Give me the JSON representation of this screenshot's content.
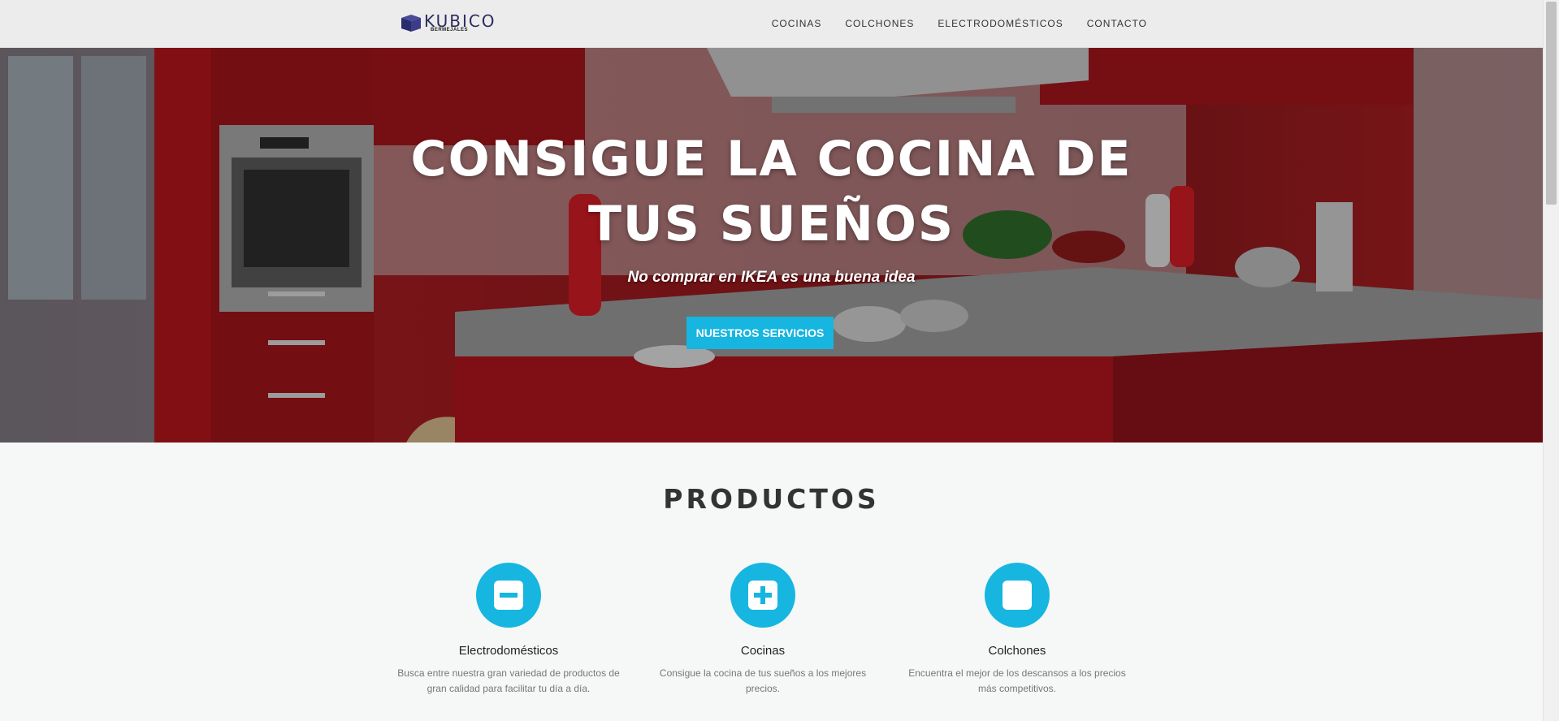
{
  "navbar": {
    "logo_text": "KUBICO",
    "logo_sub": "BERMEJALES",
    "links": [
      {
        "label": "COCINAS"
      },
      {
        "label": "COLCHONES"
      },
      {
        "label": "ELECTRODOMÉSTICOS"
      },
      {
        "label": "CONTACTO"
      }
    ]
  },
  "hero": {
    "title_line1": "CONSIGUE LA COCINA DE",
    "title_line2": "TUS SUEÑOS",
    "subtitle": "No comprar en IKEA es una buena idea",
    "button_label": "NUESTROS SERVICIOS"
  },
  "products": {
    "title": "PRODUCTOS",
    "items": [
      {
        "icon": "minus-square-icon",
        "name": "Electrodomésticos",
        "desc_line1": "Busca entre nuestra gran variedad de productos de",
        "desc_line2": "gran calidad para facilitar tu día a día."
      },
      {
        "icon": "plus-square-icon",
        "name": "Cocinas",
        "desc_line1": "Consigue la cocina de tus sueños a los mejores",
        "desc_line2": "precios."
      },
      {
        "icon": "square-icon",
        "name": "Colchones",
        "desc_line1": "Encuentra el mejor de los descansos a los precios",
        "desc_line2": "más competitivos."
      }
    ]
  },
  "colors": {
    "accent": "#16b6e0",
    "navbar_bg": "#ececec",
    "kitchen_red": "#a81c22"
  }
}
